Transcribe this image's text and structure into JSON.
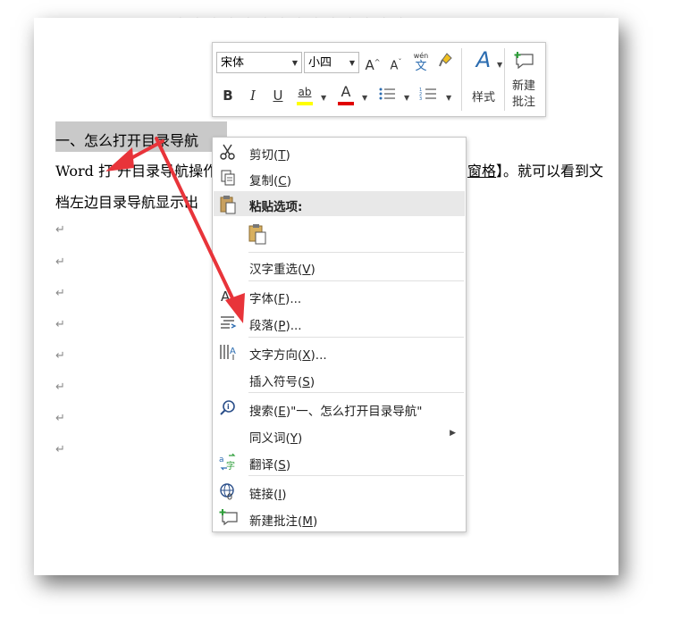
{
  "document": {
    "heading": "一、怎么打开目录导航",
    "line2_start": "Word 打",
    "line2_mid": "开目录导航操作",
    "link_text": "窗格",
    "line2_end": "】。就可以看到文",
    "line3": "档左边目录导航显示出",
    "para_mark": "↵"
  },
  "mini_toolbar": {
    "font_name": "宋体",
    "font_size": "小四",
    "grow_font": "A",
    "shrink_font": "A",
    "phonetic": "文",
    "phonetic_top": "wén",
    "bold": "B",
    "italic": "I",
    "underline": "U",
    "highlight": "ab",
    "font_color": "A",
    "styles_label": "样式",
    "new_comment_label_1": "新建",
    "new_comment_label_2": "批注",
    "colors": {
      "highlight": "#ffff00",
      "font_color": "#e00000"
    }
  },
  "context_menu": {
    "items": [
      {
        "label": "剪切(T)",
        "text": "剪切(",
        "key": "T",
        "tail": ")"
      },
      {
        "label": "复制(C)",
        "text": "复制(",
        "key": "C",
        "tail": ")"
      },
      {
        "label": "粘贴选项:"
      },
      {
        "label": "汉字重选(V)",
        "text": "汉字重选(",
        "key": "V",
        "tail": ")"
      },
      {
        "label": "字体(F)...",
        "text": "字体(",
        "key": "F",
        "tail": ")..."
      },
      {
        "label": "段落(P)...",
        "text": "段落(",
        "key": "P",
        "tail": ")..."
      },
      {
        "label": "文字方向(X)...",
        "text": "文字方向(",
        "key": "X",
        "tail": ")..."
      },
      {
        "label": "插入符号(S)",
        "text": "插入符号(",
        "key": "S",
        "tail": ")"
      },
      {
        "label": "搜索(E)\"一、怎么打开目录导航\"",
        "text": "搜索(",
        "key": "E",
        "tail": ")\"一、怎么打开目录导航\""
      },
      {
        "label": "同义词(Y)",
        "text": "同义词(",
        "key": "Y",
        "tail": ")"
      },
      {
        "label": "翻译(S)",
        "text": "翻译(",
        "key": "S",
        "tail": ")"
      },
      {
        "label": "链接(I)",
        "text": "链接(",
        "key": "I",
        "tail": ")"
      },
      {
        "label": "新建批注(M)",
        "text": "新建批注(",
        "key": "M",
        "tail": ")"
      }
    ]
  },
  "annotation": {
    "arrow_color": "#e8343a"
  }
}
